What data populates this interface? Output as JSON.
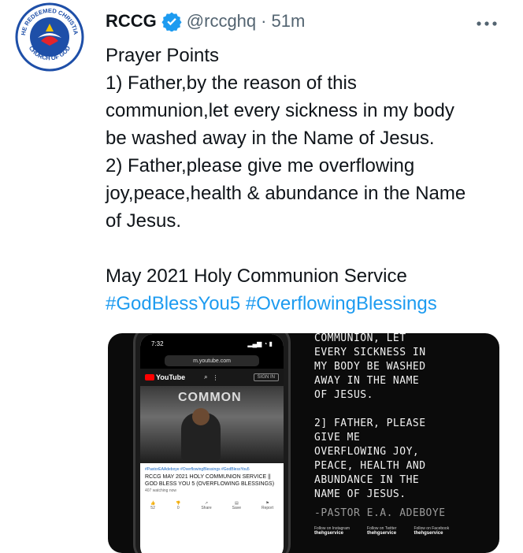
{
  "tweet": {
    "display_name": "RCCG",
    "handle": "@rccghq",
    "separator": "·",
    "time": "51m",
    "avatar": {
      "logo_text": "THE REDEEMED CHRISTIAN CHURCH OF GOD",
      "logo_text_top": "THE REDEEMED CHRISTIAN",
      "logo_text_bottom": "CHURCH OF GOD",
      "colors": {
        "ring": "#1e4fa8",
        "dove": "#e3242b"
      }
    },
    "icons": {
      "verified": "verified-badge-icon",
      "more": "more-options-icon"
    },
    "lines": [
      "Prayer Points",
      "1) Father,by the reason of this",
      "communion,let every sickness in my body",
      "be washed away in the Name of Jesus.",
      "2) Father,please give me overflowing",
      "joy,peace,health & abundance in the Name",
      "of Jesus.",
      "",
      "May 2021 Holy Communion Service"
    ],
    "hashtags": "#GodBlessYou5 #OverflowingBlessings",
    "colors": {
      "link": "#1d9bf0",
      "verified": "#1d9bf0",
      "secondary": "#536471"
    }
  },
  "media": {
    "phone": {
      "clock": "7:32",
      "url": "m.youtube.com",
      "site": "YouTube",
      "signin": "SIGN IN",
      "video_overlay": "COMMON",
      "video_tags": "#PastorEAAdeboye #OverflowingBlessings #GodBlessYou5",
      "video_title": "RCCG MAY 2021 HOLY COMMUNION SERVICE || GOD BLESS YOU 5 (OVERFLOWING BLESSINGS)",
      "views": "407 watching now",
      "actions": [
        {
          "label": "52"
        },
        {
          "label": "0"
        },
        {
          "label": "Share"
        },
        {
          "label": "Save"
        },
        {
          "label": "Report"
        }
      ]
    },
    "quote_lines": [
      "COMMUNION, LET",
      "EVERY SICKNESS IN",
      "MY BODY BE WASHED",
      "AWAY IN THE NAME",
      "OF JESUS.",
      "",
      "2] FATHER, PLEASE",
      "GIVE ME",
      "OVERFLOWING JOY,",
      "PEACE, HEALTH AND",
      "ABUNDANCE IN THE",
      "NAME OF JESUS."
    ],
    "attribution": "-PASTOR E.A. ADEBOYE",
    "socials": [
      {
        "label": "Follow on Instagram",
        "handle": "thehgservice"
      },
      {
        "label": "Follow on Twitter",
        "handle": "thehgservice"
      },
      {
        "label": "Follow on Facebook",
        "handle": "thehgservice"
      }
    ]
  }
}
